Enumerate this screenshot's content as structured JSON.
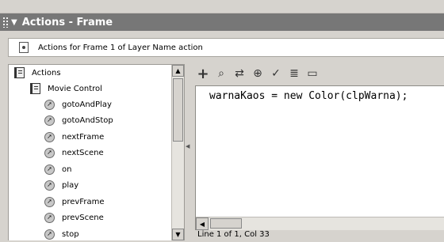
{
  "panel": {
    "title": "Actions - Frame",
    "frame_label": "Actions for Frame 1 of Layer Name action"
  },
  "tree": {
    "items": [
      {
        "label": "Actions",
        "icon": "book-icon",
        "level": 0
      },
      {
        "label": "Movie Control",
        "icon": "book-icon",
        "level": 1
      },
      {
        "label": "gotoAndPlay",
        "icon": "action-icon",
        "level": 2
      },
      {
        "label": "gotoAndStop",
        "icon": "action-icon",
        "level": 2
      },
      {
        "label": "nextFrame",
        "icon": "action-icon",
        "level": 2
      },
      {
        "label": "nextScene",
        "icon": "action-icon",
        "level": 2
      },
      {
        "label": "on",
        "icon": "action-icon",
        "level": 2
      },
      {
        "label": "play",
        "icon": "action-icon",
        "level": 2
      },
      {
        "label": "prevFrame",
        "icon": "action-icon",
        "level": 2
      },
      {
        "label": "prevScene",
        "icon": "action-icon",
        "level": 2
      },
      {
        "label": "stop",
        "icon": "action-icon",
        "level": 2
      }
    ]
  },
  "toolbar": {
    "icons": [
      "add-icon",
      "find-icon",
      "replace-icon",
      "insert-target-path-icon",
      "check-syntax-icon",
      "auto-format-icon",
      "code-hint-icon"
    ]
  },
  "editor": {
    "code": "warnaKaos = new Color(clpWarna);",
    "status": "Line 1 of 1, Col 33"
  },
  "colors": {
    "titlebar": "#777777",
    "panel": "#d6d3ce"
  }
}
